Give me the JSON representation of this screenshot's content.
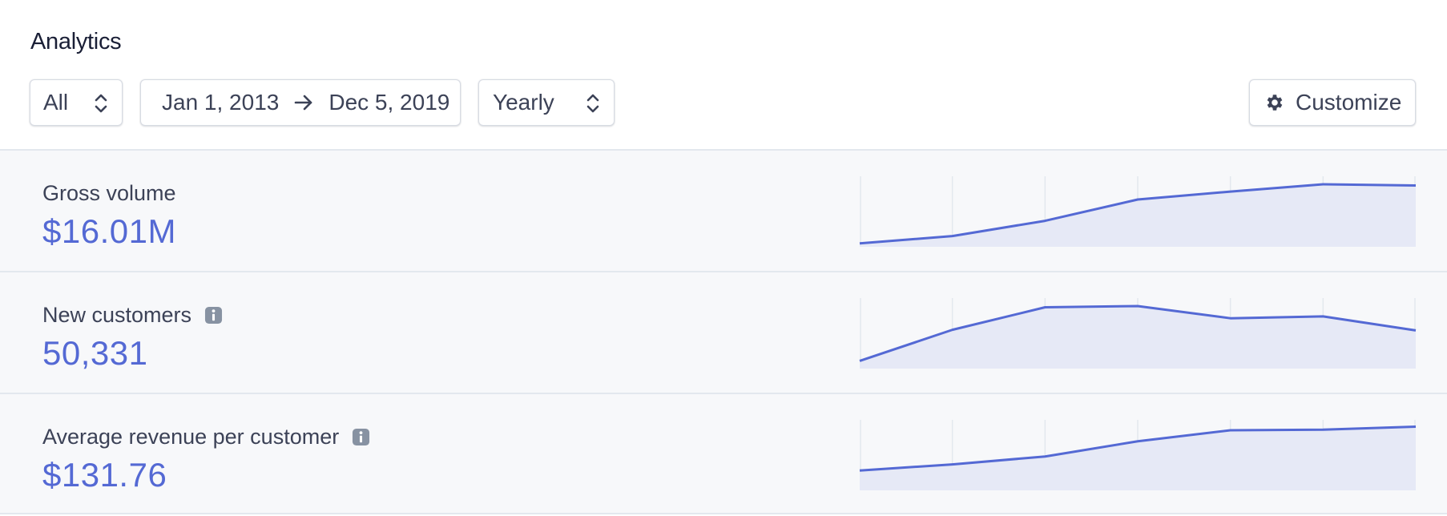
{
  "header": {
    "title": "Analytics"
  },
  "filters": {
    "scope": {
      "selected": "All"
    },
    "date_range": {
      "start": "Jan 1, 2013",
      "end": "Dec 5, 2019"
    },
    "interval": {
      "selected": "Yearly"
    },
    "customize_label": "Customize"
  },
  "colors": {
    "accent": "#5469d4",
    "fill": "#e6e9f6",
    "grid": "#e3e8ee",
    "row_bg": "#f7f8fa"
  },
  "metrics": [
    {
      "label": "Gross volume",
      "value": "$16.01M",
      "has_info": false,
      "trend": [
        0.03,
        0.15,
        0.4,
        0.75,
        0.88,
        1.0,
        0.98
      ]
    },
    {
      "label": "New customers",
      "value": "50,331",
      "has_info": true,
      "trend": [
        0.1,
        0.61,
        0.98,
        1.0,
        0.8,
        0.83,
        0.6
      ]
    },
    {
      "label": "Average revenue per customer",
      "value": "$131.76",
      "has_info": true,
      "trend": [
        0.3,
        0.4,
        0.53,
        0.78,
        0.96,
        0.97,
        1.02
      ]
    }
  ]
}
